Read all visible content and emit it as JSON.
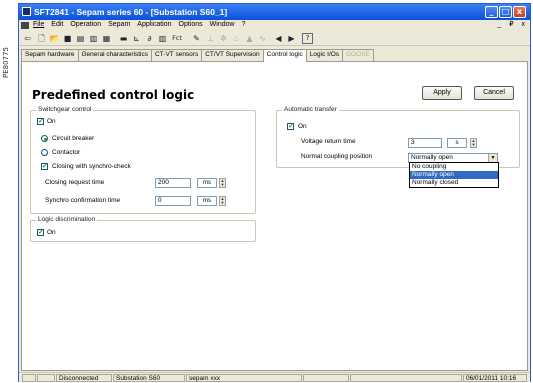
{
  "side_label": "PE80775",
  "window": {
    "title": "SFT2841 - Sepam series 60 - [Substation S60_1]",
    "controls": [
      "_",
      "□",
      "x"
    ]
  },
  "menu": {
    "items": [
      "File",
      "Edit",
      "Operation",
      "Sepam",
      "Application",
      "Options",
      "Window",
      "?"
    ],
    "mdi_controls": "_ ₽ x"
  },
  "toolbar": {
    "icons": [
      "back-icon",
      "new-icon",
      "open-icon",
      "save-icon",
      "print-icon",
      "print-preview-icon",
      "print-setup-icon",
      "connect-icon",
      "chart-icon",
      "logic-icon",
      "grid-icon",
      "fct-icon",
      "tools-icon",
      "disabled-tool-1-icon",
      "disabled-tool-2-icon",
      "disabled-tool-3-icon",
      "disabled-tool-4-icon",
      "disabled-tool-5-icon",
      "send-icon",
      "receive-icon",
      "help-icon"
    ],
    "fct_label": "Fct"
  },
  "tabs": [
    {
      "label": "Sepam hardware",
      "state": "normal"
    },
    {
      "label": "General characteristics",
      "state": "normal"
    },
    {
      "label": "CT-VT sensors",
      "state": "normal"
    },
    {
      "label": "CT/VT Supervision",
      "state": "normal"
    },
    {
      "label": "Control logic",
      "state": "active"
    },
    {
      "label": "Logic I/Os",
      "state": "normal"
    },
    {
      "label": "GOOSE",
      "state": "disabled"
    }
  ],
  "page": {
    "heading": "Predefined control logic",
    "apply_label": "Apply",
    "cancel_label": "Cancel"
  },
  "switchgear": {
    "legend": "Switchgear control",
    "on_label": "On",
    "on_checked": true,
    "breaker_label": "Circuit breaker",
    "breaker_selected": true,
    "contactor_label": "Contactor",
    "contactor_selected": false,
    "sync_label": "Closing with synchro-check",
    "sync_checked": true,
    "closing_time_label": "Closing request time",
    "closing_time_value": "200",
    "closing_time_unit": "ms",
    "sync_time_label": "Synchro confirmation time",
    "sync_time_value": "0",
    "sync_time_unit": "ms"
  },
  "logic_discrimination": {
    "legend": "Logic discrimination",
    "on_label": "On",
    "on_checked": true
  },
  "automatic_transfer": {
    "legend": "Automatic transfer",
    "on_label": "On",
    "on_checked": true,
    "voltage_return_label": "Voltage return time",
    "voltage_return_value": "3",
    "voltage_return_unit": "s",
    "coupling_label": "Normal coupling position",
    "coupling_selected": "Normally open",
    "coupling_options": [
      "No coupling",
      "Normally open",
      "Normally closed"
    ],
    "coupling_highlighted_index": 1
  },
  "status": {
    "connection": "Disconnected",
    "substation": "Substation S60",
    "sepam": "sepam xxx",
    "datetime": "06/01/2011  10:16"
  },
  "colors": {
    "title_bar": "#0a4fd8",
    "selection": "#316ac5",
    "check_mark": "#1a9d1a"
  }
}
